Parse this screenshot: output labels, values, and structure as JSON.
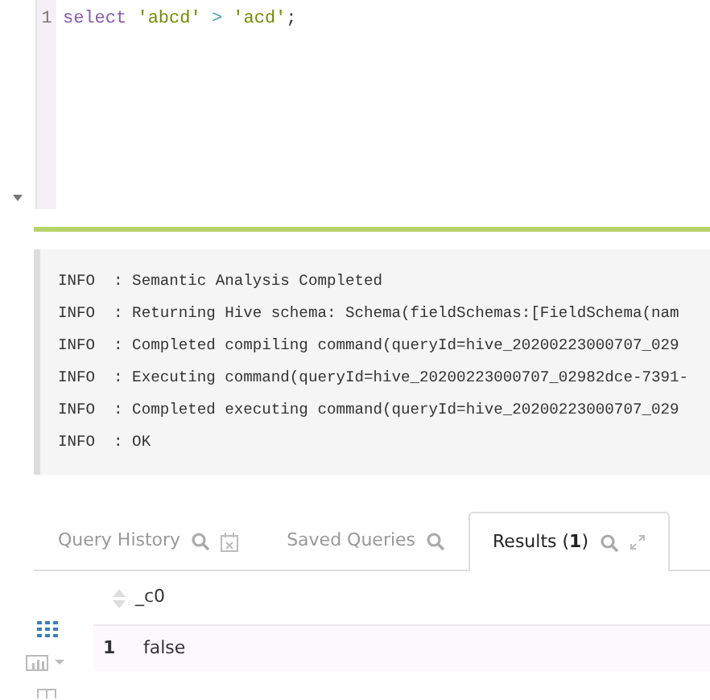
{
  "editor": {
    "lines": [
      {
        "number": "1",
        "tokens": [
          {
            "kind": "keyword",
            "text": "select "
          },
          {
            "kind": "string",
            "text": "'abcd' "
          },
          {
            "kind": "operator",
            "text": "> "
          },
          {
            "kind": "string",
            "text": "'acd'"
          },
          {
            "kind": "punct",
            "text": ";"
          }
        ]
      }
    ]
  },
  "progress": {
    "level": 1
  },
  "log": {
    "lines": [
      "INFO  : Semantic Analysis Completed",
      "INFO  : Returning Hive schema: Schema(fieldSchemas:[FieldSchema(nam",
      "INFO  : Completed compiling command(queryId=hive_20200223000707_029",
      "INFO  : Executing command(queryId=hive_20200223000707_02982dce-7391-",
      "INFO  : Completed executing command(queryId=hive_20200223000707_029",
      "INFO  : OK"
    ]
  },
  "tabs": [
    {
      "label": "Query History",
      "selected": false
    },
    {
      "label": "Saved Queries",
      "selected": false
    },
    {
      "label": "Results (**1**)",
      "selected": true
    }
  ],
  "results": {
    "columns": [
      "_c0"
    ],
    "rows": [
      {
        "number": "1",
        "cells": [
          "false"
        ]
      }
    ]
  }
}
